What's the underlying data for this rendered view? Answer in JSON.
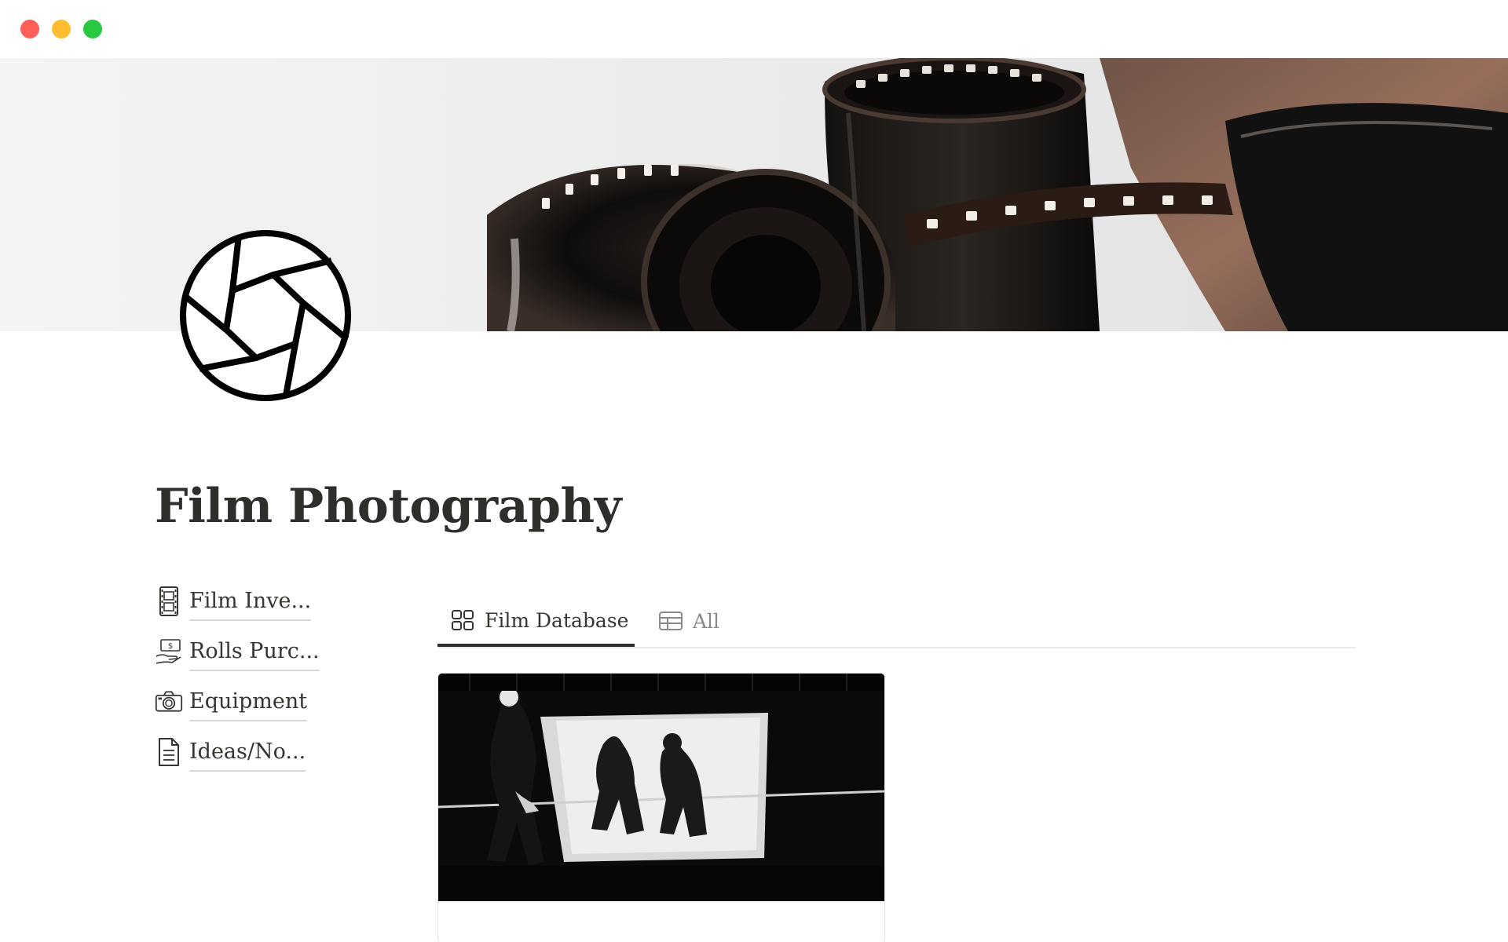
{
  "window": {
    "traffic_lights": [
      "close",
      "minimize",
      "maximize"
    ],
    "colors": {
      "close": "#fe5f57",
      "minimize": "#febc2e",
      "maximize": "#28c840"
    }
  },
  "cover": {
    "icon": "film-reels-cover-image"
  },
  "page": {
    "icon": "camera-aperture-icon",
    "title": "Film Photography"
  },
  "links": [
    {
      "icon": "film-strip-icon",
      "label": "Film Inve..."
    },
    {
      "icon": "money-hand-icon",
      "label": "Rolls Purc..."
    },
    {
      "icon": "camera-icon",
      "label": "Equipment"
    },
    {
      "icon": "document-icon",
      "label": "Ideas/No..."
    }
  ],
  "tabs": [
    {
      "icon": "gallery-grid-icon",
      "label": "Film Database",
      "active": true
    },
    {
      "icon": "table-icon",
      "label": "All",
      "active": false
    }
  ],
  "gallery": {
    "cards": [
      {
        "image": "street-shadows-photo"
      }
    ]
  }
}
